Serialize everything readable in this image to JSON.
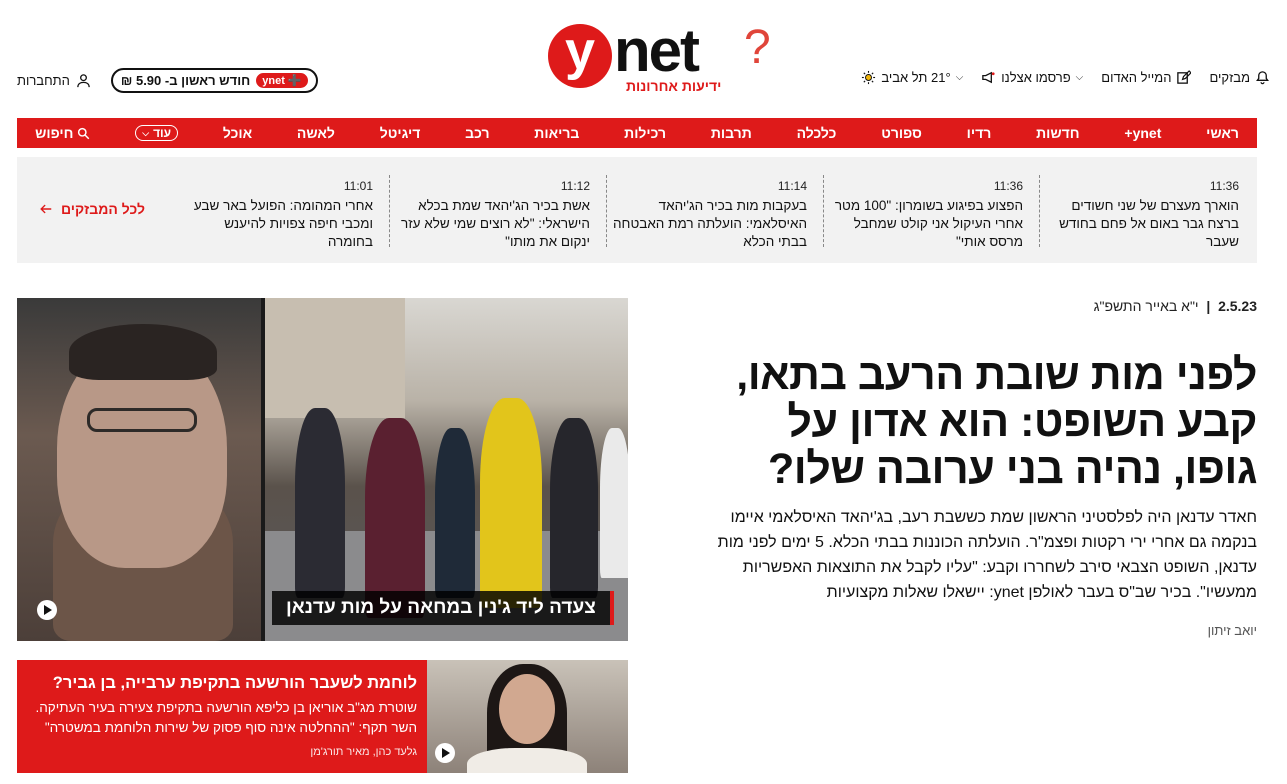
{
  "header": {
    "items_right": [
      {
        "label": "מבזקים",
        "icon": "bell-icon"
      },
      {
        "label": "המייל האדום",
        "icon": "edit-icon"
      },
      {
        "label": "פרסמו אצלנו",
        "icon": "megaphone-icon"
      },
      {
        "label": "21° תל אביב",
        "icon": "sun-icon"
      }
    ],
    "logo": {
      "circle": "y",
      "word": "net",
      "question": "?",
      "subtitle": "ידיעות אחרונות"
    },
    "login_label": "התחברות",
    "subscribe": {
      "badge": "ynet",
      "text": "חודש ראשון ב- 5.90 ₪"
    }
  },
  "nav": {
    "items": [
      "ראשי",
      "ynet+",
      "חדשות",
      "רדיו",
      "ספורט",
      "כלכלה",
      "תרבות",
      "רכילות",
      "בריאות",
      "רכב",
      "דיגיטל",
      "לאשה",
      "אוכל"
    ],
    "more_label": "עוד",
    "search_label": "חיפוש"
  },
  "flash": {
    "items": [
      {
        "time": "11:36",
        "text": "הוארך מעצרם של שני חשודים ברצח גבר באום אל פחם בחודש שעבר"
      },
      {
        "time": "11:36",
        "text": "הפצוע בפיגוע בשומרון: \"100 מטר אחרי העיקול אני קולט שמחבל מרסס אותי\""
      },
      {
        "time": "11:14",
        "text": "בעקבות מות בכיר הג'יהאד האיסלאמי: הועלתה רמת האבטחה בבתי הכלא"
      },
      {
        "time": "11:12",
        "text": "אשת בכיר הג'יהאד שמת בכלא הישראלי: \"לא רוצים שמי שלא עזר ינקום את מותו\""
      },
      {
        "time": "11:01",
        "text": "אחרי המהומה: הפועל באר שבע ומכבי חיפה צפויות להיענש בחומרה"
      }
    ],
    "all_label": "לכל המבזקים"
  },
  "main_article": {
    "date": "2.5.23",
    "hebrew_date": "י\"א באייר התשפ\"ג",
    "headline": "לפני מות שובת הרעב בתאו, קבע השופט: הוא אדון על גופו, נהיה בני ערובה שלו?",
    "subhead": "חאדר עדנאן היה לפלסטיני הראשון שמת כששבת רעב, בג'יהאד האיסלאמי איימו בנקמה גם אחרי ירי רקטות ופצמ\"ר. הועלתה הכוננות בבתי הכלא. 5 ימים לפני מות עדנאן, השופט הצבאי סירב לשחררו וקבע: \"עליו לקבל את התוצאות האפשריות ממעשיו\". בכיר שב\"ס בעבר לאולפן ynet: יישאלו שאלות מקצועיות",
    "author": "יואב זיתון",
    "image_caption": "צעדה ליד ג'נין במחאה על מות עדנאן"
  },
  "second_article": {
    "title": "לוחמת לשעבר הורשעה בתקיפת ערבייה, בן גביר?",
    "subtitle": "שוטרת מג\"ב אוריאן בן כליפא הורשעה בתקיפת צעירה בעיר העתיקה. השר תקף: \"ההחלטה אינה סוף פסוק של שירות הלוחמת במשטרה\"",
    "author": "גלעד כהן, מאיר תורג'מן"
  },
  "colors": {
    "brand_red": "#de1a1a",
    "flash_bg": "#f2f2f2"
  }
}
